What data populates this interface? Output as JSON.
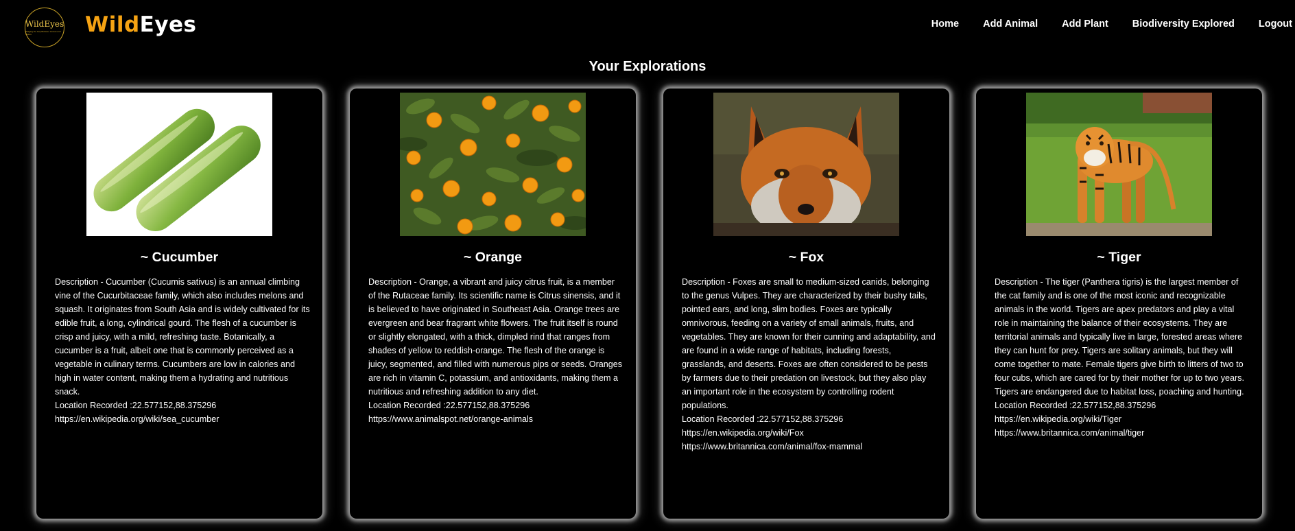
{
  "header": {
    "logo_text": "WildEyes",
    "logo_tagline": "Bridging the Gap Between Human and Nature",
    "brand_part1": "Wild",
    "brand_part2": "Eyes",
    "nav": [
      "Home",
      "Add Animal",
      "Add Plant",
      "Biodiversity Explored",
      "Logout"
    ]
  },
  "page_title": "Your Explorations",
  "colors": {
    "brand_accent": "#f6a313",
    "background": "#000000",
    "text": "#ffffff"
  },
  "cards": [
    {
      "title": "~ Cucumber",
      "image": "cucumber-photo",
      "description": "Description - Cucumber (Cucumis sativus) is an annual climbing vine of the Cucurbitaceae family, which also includes melons and squash. It originates from South Asia and is widely cultivated for its edible fruit, a long, cylindrical gourd. The flesh of a cucumber is crisp and juicy, with a mild, refreshing taste. Botanically, a cucumber is a fruit, albeit one that is commonly perceived as a vegetable in culinary terms. Cucumbers are low in calories and high in water content, making them a hydrating and nutritious snack.",
      "location": "Location Recorded :22.577152,88.375296",
      "links": [
        "https://en.wikipedia.org/wiki/sea_cucumber"
      ]
    },
    {
      "title": "~ Orange",
      "image": "orange-tree-photo",
      "description": "Description - Orange, a vibrant and juicy citrus fruit, is a member of the Rutaceae family. Its scientific name is Citrus sinensis, and it is believed to have originated in Southeast Asia. Orange trees are evergreen and bear fragrant white flowers. The fruit itself is round or slightly elongated, with a thick, dimpled rind that ranges from shades of yellow to reddish-orange. The flesh of the orange is juicy, segmented, and filled with numerous pips or seeds. Oranges are rich in vitamin C, potassium, and antioxidants, making them a nutritious and refreshing addition to any diet.",
      "location": "Location Recorded :22.577152,88.375296",
      "links": [
        "https://www.animalspot.net/orange-animals"
      ]
    },
    {
      "title": "~ Fox",
      "image": "fox-photo",
      "description": "Description - Foxes are small to medium-sized canids, belonging to the genus Vulpes. They are characterized by their bushy tails, pointed ears, and long, slim bodies. Foxes are typically omnivorous, feeding on a variety of small animals, fruits, and vegetables. They are known for their cunning and adaptability, and are found in a wide range of habitats, including forests, grasslands, and deserts. Foxes are often considered to be pests by farmers due to their predation on livestock, but they also play an important role in the ecosystem by controlling rodent populations.",
      "location": "Location Recorded :22.577152,88.375296",
      "links": [
        "https://en.wikipedia.org/wiki/Fox",
        "https://www.britannica.com/animal/fox-mammal"
      ]
    },
    {
      "title": "~ Tiger",
      "image": "tiger-photo",
      "description": "Description - The tiger (Panthera tigris) is the largest member of the cat family and is one of the most iconic and recognizable animals in the world. Tigers are apex predators and play a vital role in maintaining the balance of their ecosystems. They are territorial animals and typically live in large, forested areas where they can hunt for prey. Tigers are solitary animals, but they will come together to mate. Female tigers give birth to litters of two to four cubs, which are cared for by their mother for up to two years. Tigers are endangered due to habitat loss, poaching and hunting.",
      "location": "Location Recorded :22.577152,88.375296",
      "links": [
        "https://en.wikipedia.org/wiki/Tiger",
        "https://www.britannica.com/animal/tiger"
      ]
    }
  ]
}
